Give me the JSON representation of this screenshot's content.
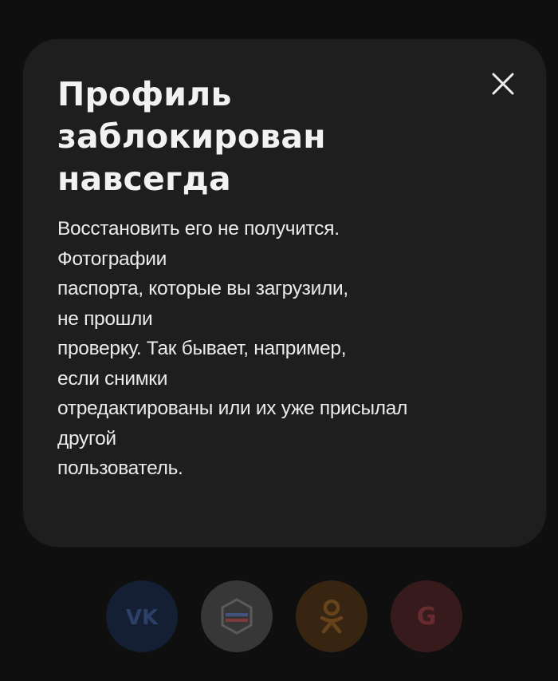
{
  "modal": {
    "title_lines": [
      "Профиль",
      "заблокирован",
      "навсегда"
    ],
    "body_lines": [
      "Восстановить его не получится.",
      "Фотографии",
      "паспорта, которые вы загрузили,",
      "не прошли",
      "проверку. Так бывает, например,",
      "если снимки",
      "отредактированы или их уже присылал",
      "другой",
      "пользователь."
    ],
    "close_icon": "close-icon"
  },
  "social_login": {
    "buttons": [
      {
        "id": "vk",
        "label": "VK",
        "icon": "vk-logo-icon",
        "color": "#1d2a45"
      },
      {
        "id": "gosuslugi",
        "icon": "gosuslugi-logo-icon",
        "color": "#4a4a4a"
      },
      {
        "id": "ok",
        "icon": "odnoklassniki-logo-icon",
        "color": "#4a3219"
      },
      {
        "id": "google",
        "label": "G",
        "icon": "google-logo-icon",
        "color": "#4a2326"
      }
    ]
  },
  "colors": {
    "background": "#141414",
    "modal_background": "#1e1e1e",
    "text_primary": "#f2f2f2"
  }
}
